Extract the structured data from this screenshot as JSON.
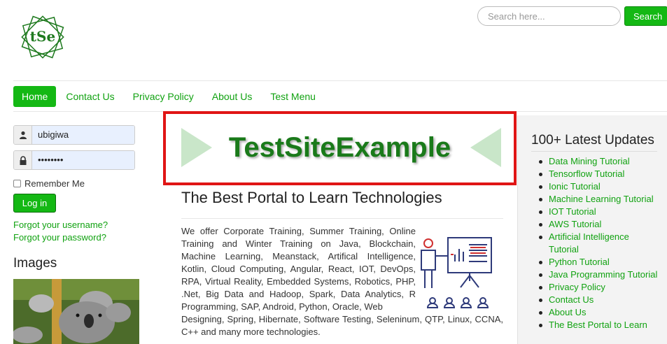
{
  "logo": {
    "text": "tSe"
  },
  "search": {
    "placeholder": "Search here...",
    "button_label": "Search"
  },
  "nav": {
    "items": [
      {
        "label": "Home",
        "active": true
      },
      {
        "label": "Contact Us"
      },
      {
        "label": "Privacy Policy"
      },
      {
        "label": "About Us"
      },
      {
        "label": "Test Menu"
      }
    ]
  },
  "login": {
    "username_value": "ubigiwa",
    "password_value": "••••••••",
    "remember_label": "Remember Me",
    "login_button": "Log in",
    "forgot_username": "Forgot your username?",
    "forgot_password": "Forgot your password?"
  },
  "images": {
    "title": "Images"
  },
  "banner": {
    "title": "TestSiteExample"
  },
  "main": {
    "heading": "The Best Portal to Learn Technologies",
    "paragraph_part1": "We offer Corporate Training, Summer Training, Online Training and Winter Training on Java, Blockchain, Machine Learning, Meanstack, Artifical Intelligence, Kotlin, Cloud Computing, Angular, React, IOT, DevOps, RPA, Virtual Reality, Embedded Systems, Robotics, PHP, .Net, Big Data and Hadoop, Spark, Data Analytics, R Programming, SAP, Android, Python, Oracle, Web",
    "paragraph_part2": "Designing, Spring, Hibernate, Software Testing, Seleninum, QTP, Linux, CCNA, C++ and many more technologies."
  },
  "updates": {
    "title": "100+ Latest Updates",
    "items": [
      "Data Mining Tutorial",
      "Tensorflow Tutorial",
      "Ionic Tutorial",
      "Machine Learning Tutorial",
      "IOT Tutorial",
      "AWS Tutorial",
      "Artificial Intelligence Tutorial",
      "Python Tutorial",
      "Java Programming Tutorial",
      "Privacy Policy",
      "Contact Us",
      "About Us",
      "The Best Portal to Learn"
    ]
  },
  "colors": {
    "accent": "#14b814",
    "link": "#11a211",
    "banner_border": "#e01515",
    "banner_text": "#1a7a1a"
  }
}
